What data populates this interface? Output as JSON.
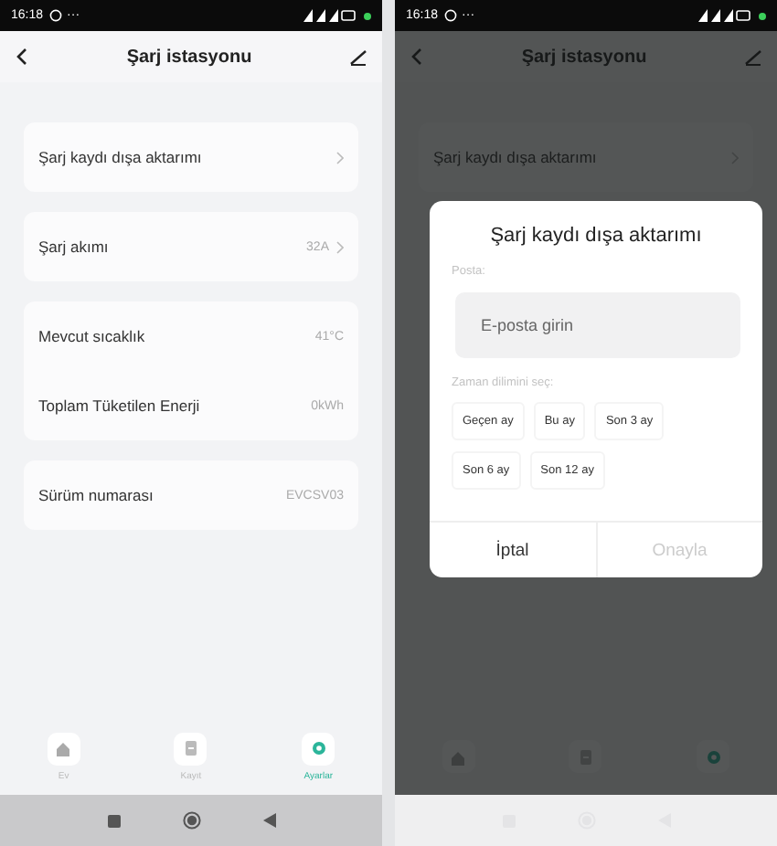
{
  "screens": [
    {
      "status_bar": {
        "time": "16:18",
        "extra": "···"
      },
      "header": {
        "title": "Şarj istasyonu"
      },
      "groups": [
        [
          {
            "label": "Şarj kaydı dışa aktarımı",
            "chevron": true
          }
        ],
        [
          {
            "label": "Şarj akımı",
            "value": "32A",
            "chevron": true
          }
        ],
        [
          {
            "label": "Mevcut sıcaklık",
            "value": "41°C",
            "chevron": false
          },
          {
            "label": "Toplam Tüketilen Enerji",
            "value": "0kWh",
            "chevron": false
          }
        ],
        [
          {
            "label": "Sürüm numarası",
            "value": "EVCSV03",
            "chevron": false
          }
        ]
      ],
      "tabs": [
        {
          "label": "Ev",
          "kind": "home",
          "selected": false
        },
        {
          "label": "Kayıt",
          "kind": "record",
          "selected": false
        },
        {
          "label": "Ayarlar",
          "kind": "settings",
          "selected": true
        }
      ]
    },
    {
      "status_bar": {
        "time": "16:18",
        "extra": "···"
      },
      "header": {
        "title": "Şarj istasyonu"
      },
      "groups": [
        [
          {
            "label": "Şarj kaydı dışa aktarımı",
            "chevron": true
          }
        ]
      ],
      "tabs": [
        {
          "kind": "home",
          "selected": false
        },
        {
          "kind": "record",
          "selected": false
        },
        {
          "kind": "settings",
          "selected": true
        }
      ],
      "dialog": {
        "title": "Şarj kaydı dışa aktarımı",
        "email_label": "Posta:",
        "email_placeholder": "E-posta girin",
        "period_label": "Zaman dilimini seç:",
        "periods": [
          {
            "label": "Geçen ay",
            "selected": false
          },
          {
            "label": "Bu ay",
            "selected": false
          },
          {
            "label": "Son 3 ay",
            "selected": false
          },
          {
            "label": "Son 6 ay",
            "selected": false
          },
          {
            "label": "Son 12 ay",
            "selected": false
          }
        ],
        "cancel": {
          "label": "İptal",
          "disabled": false
        },
        "confirm": {
          "label": "Onayla",
          "disabled": true
        }
      }
    }
  ]
}
